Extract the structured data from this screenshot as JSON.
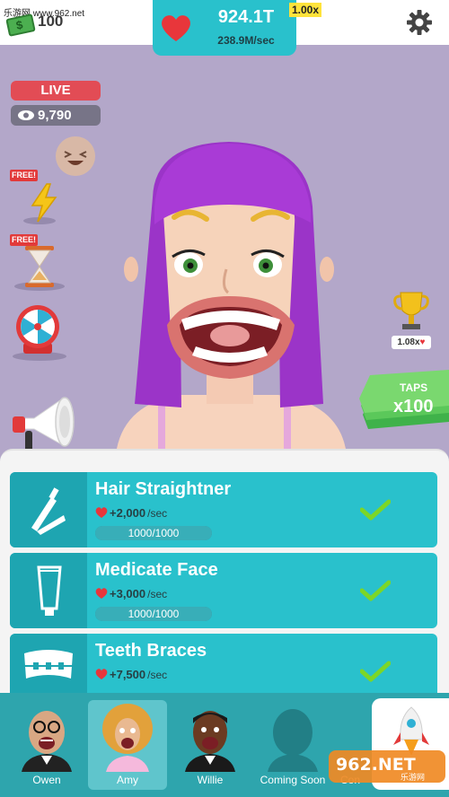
{
  "watermark": {
    "site": "乐游网 www.962.net",
    "brand": "962.NET",
    "brand_sub": "乐游网"
  },
  "currency": {
    "cash": "100",
    "score": "924.1T",
    "rate": "238.9M/sec",
    "multiplier": "1.00x"
  },
  "live": {
    "label": "LIVE",
    "viewers": "9,790"
  },
  "powerups": {
    "free_label": "FREE!"
  },
  "trophy": {
    "multiplier": "1.08x"
  },
  "taps": {
    "label": "TAPS",
    "count": "x100"
  },
  "upgrades": [
    {
      "title": "Hair Straightner",
      "rate": "+2,000",
      "unit": "/sec",
      "progress_text": "1000/1000",
      "progress": 1.0,
      "icon": "hair-straightener-icon"
    },
    {
      "title": "Medicate Face",
      "rate": "+3,000",
      "unit": "/sec",
      "progress_text": "1000/1000",
      "progress": 1.0,
      "icon": "cream-tube-icon"
    },
    {
      "title": "Teeth Braces",
      "rate": "+7,500",
      "unit": "/sec",
      "progress_text": "",
      "progress": 1.0,
      "icon": "braces-icon"
    }
  ],
  "characters": [
    {
      "name": "Owen",
      "selected": false
    },
    {
      "name": "Amy",
      "selected": true
    },
    {
      "name": "Willie",
      "selected": false
    },
    {
      "name": "Coming Soon",
      "selected": false
    },
    {
      "name": "Con",
      "selected": false
    }
  ],
  "colors": {
    "accent": "#29c1cc",
    "heart": "#e8363b",
    "check": "#7cd627",
    "live": "#e24c55",
    "multiplier": "#ffe33b"
  }
}
